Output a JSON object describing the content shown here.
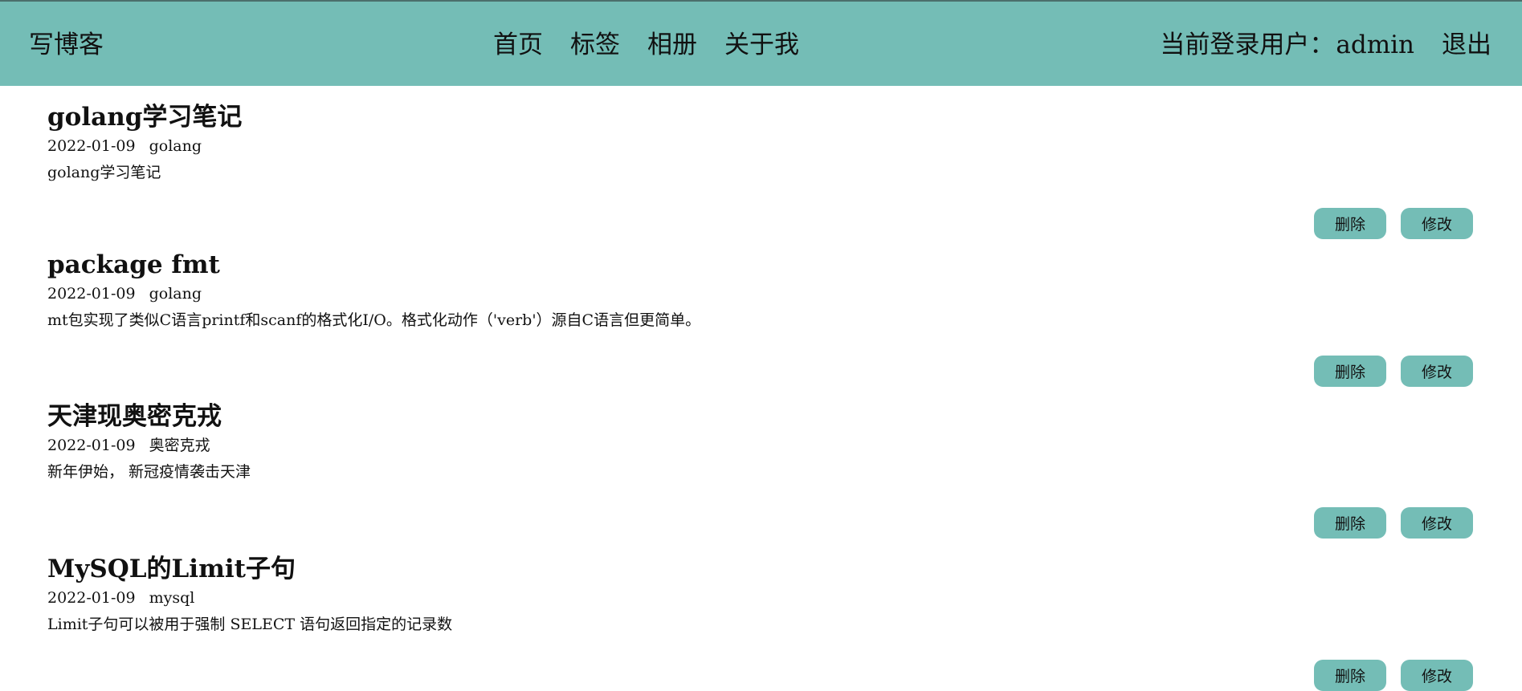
{
  "header": {
    "brand": "写博客",
    "nav": [
      "首页",
      "标签",
      "相册",
      "关于我"
    ],
    "user_label": "当前登录用户：",
    "user_name": "admin",
    "logout": "退出"
  },
  "colors": {
    "accent": "#74bdb6",
    "header_border": "#4b6f6c"
  },
  "posts": [
    {
      "title": "golang学习笔记",
      "date": "2022-01-09",
      "tag": "golang",
      "summary": "golang学习笔记",
      "delete_label": "删除",
      "edit_label": "修改"
    },
    {
      "title": "package fmt",
      "date": "2022-01-09",
      "tag": "golang",
      "summary": "mt包实现了类似C语言printf和scanf的格式化I/O。格式化动作（'verb'）源自C语言但更简单。",
      "delete_label": "删除",
      "edit_label": "修改"
    },
    {
      "title": "天津现奥密克戎",
      "date": "2022-01-09",
      "tag": "奥密克戎",
      "summary": "新年伊始， 新冠疫情袭击天津",
      "delete_label": "删除",
      "edit_label": "修改"
    },
    {
      "title": "MySQL的Limit子句",
      "date": "2022-01-09",
      "tag": "mysql",
      "summary": "Limit子句可以被用于强制 SELECT 语句返回指定的记录数",
      "delete_label": "删除",
      "edit_label": "修改"
    }
  ]
}
